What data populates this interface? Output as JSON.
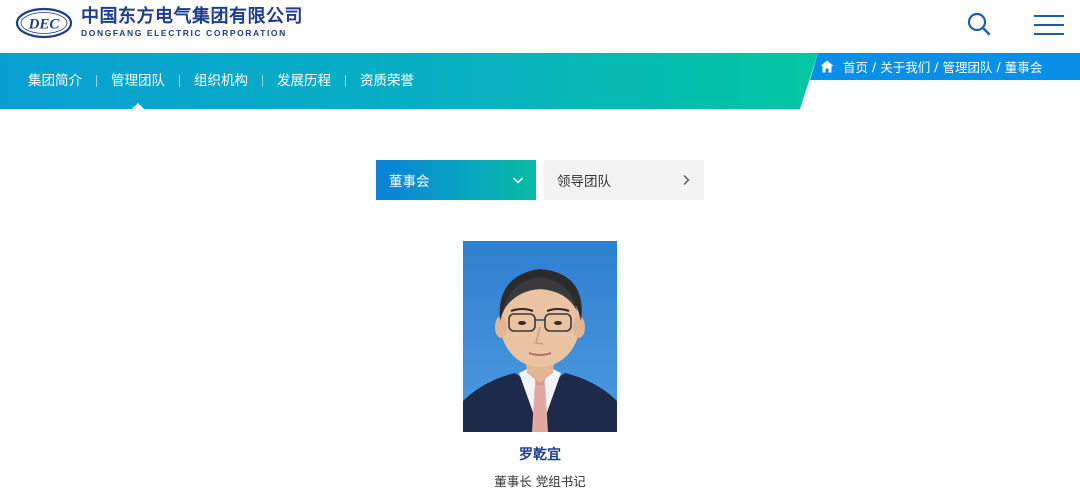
{
  "header": {
    "logo_mark": "DEC",
    "company_name_cn": "中国东方电气集团有限公司",
    "company_name_en": "DONGFANG ELECTRIC CORPORATION",
    "search_icon": "search-icon",
    "menu_icon": "hamburger-menu-icon"
  },
  "nav": {
    "items": [
      {
        "label": "集团简介"
      },
      {
        "label": "管理团队"
      },
      {
        "label": "组织机构"
      },
      {
        "label": "发展历程"
      },
      {
        "label": "资质荣誉"
      }
    ],
    "active_index": 1
  },
  "breadcrumb": {
    "home_icon": "home-icon",
    "items": [
      "首页",
      "关于我们",
      "管理团队",
      "董事会"
    ],
    "separator": "/"
  },
  "subtabs": {
    "active": {
      "label": "董事会",
      "icon": "chevron-down-icon"
    },
    "inactive": {
      "label": "领导团队",
      "icon": "chevron-right-icon"
    }
  },
  "person": {
    "name": "罗乾宜",
    "title": "董事长 党组书记"
  },
  "colors": {
    "brand_blue": "#1f3d8c",
    "nav_gradient_start": "#0ba0d0",
    "nav_gradient_end": "#06c2a3",
    "breadcrumb_bar": "#0a8fe6",
    "tab_inactive_bg": "#f3f3f3"
  }
}
